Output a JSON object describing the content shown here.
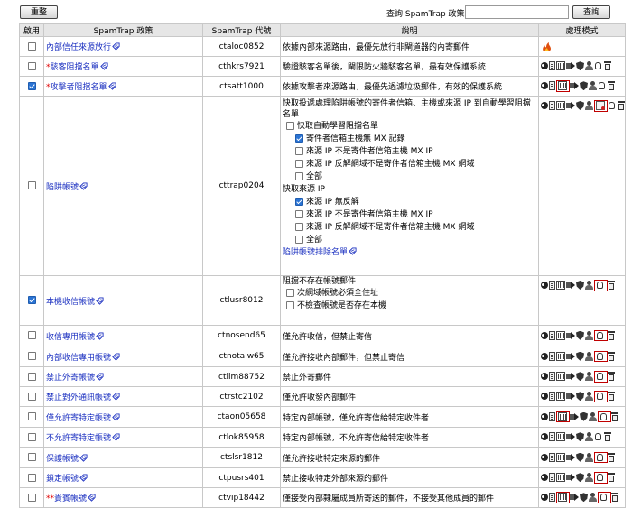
{
  "toolbar": {
    "reset_label": "重整",
    "search_label": "查詢 SpamTrap 政策",
    "search_value": "",
    "search_button": "查詢"
  },
  "columns": [
    "啟用",
    "SpamTrap 政策",
    "SpamTrap 代號",
    "說明",
    "處理模式"
  ],
  "rows": [
    {
      "enabled": false,
      "star": "",
      "name": "內部信任來源放行",
      "code": "ctaloc0852",
      "desc": "依據內部來源路由，最優先放行非閘道器的內寄郵件",
      "acts": "flame"
    },
    {
      "enabled": false,
      "star": "*",
      "name": "駭客阻擋名單",
      "code": "cthkrs7921",
      "desc": "驗證駭客名單後，閘限防火牆駭客名單，最有效保護系統",
      "acts": "std"
    },
    {
      "enabled": true,
      "star": "*",
      "name": "攻擊者阻擋名單",
      "code": "ctsatt1000",
      "desc": "依據攻擊者來源路由，最優先過濾垃圾郵件，有效的保護系統",
      "acts": "cal"
    },
    {
      "enabled": false,
      "star": "",
      "name": "陷阱帳號",
      "code": "cttrap0204",
      "desc": "快取投遞處理陷阱帳號的寄件者信箱、主機或來源 IP 到自動學習阻擋名單",
      "acts": "cert"
    },
    {
      "enabled": true,
      "star": "",
      "name": "本機收信帳號",
      "code": "ctlusr8012",
      "desc": "阻擋不存在帳號郵件",
      "acts": "hand"
    },
    {
      "enabled": false,
      "star": "",
      "name": "收信專用帳號",
      "code": "ctnosend65",
      "desc": "僅允許收信，但禁止寄信",
      "acts": "hand"
    },
    {
      "enabled": false,
      "star": "",
      "name": "內部收信專用帳號",
      "code": "ctnotalw65",
      "desc": "僅允許接收內部郵件，但禁止寄信",
      "acts": "hand"
    },
    {
      "enabled": false,
      "star": "",
      "name": "禁止外寄帳號",
      "code": "ctlim88752",
      "desc": "禁止外寄郵件",
      "acts": "hand"
    },
    {
      "enabled": false,
      "star": "",
      "name": "禁止對外通訊帳號",
      "code": "ctrstc2102",
      "desc": "僅允許收發內部郵件",
      "acts": "hand"
    },
    {
      "enabled": false,
      "star": "",
      "name": "僅允許寄特定帳號",
      "code": "ctaon05658",
      "desc": "特定內部帳號，僅允許寄信給特定收件者",
      "acts": "calhand"
    },
    {
      "enabled": false,
      "star": "",
      "name": "不允許寄特定帳號",
      "code": "ctlok85958",
      "desc": "特定內部帳號，不允許寄信給特定收件者",
      "acts": "std"
    },
    {
      "enabled": false,
      "star": "",
      "name": "保護帳號",
      "code": "ctslsr1812",
      "desc": "僅允許接收特定來源的郵件",
      "acts": "hand"
    },
    {
      "enabled": false,
      "star": "",
      "name": "鎖定帳號",
      "code": "ctpusrs401",
      "desc": "禁止接收特定外部來源的郵件",
      "acts": "hand"
    },
    {
      "enabled": false,
      "star": "**",
      "name": "貴賓帳號",
      "code": "ctvip18442",
      "desc": "僅接受內部隸屬成員所寄送的郵件，不接受其他成員的郵件",
      "acts": "calhand"
    }
  ],
  "trap_options": {
    "auto_learn": "快取自動學習阻擋名單",
    "group1": [
      {
        "checked": true,
        "label": "寄件者信箱主機無 MX 記錄"
      },
      {
        "checked": false,
        "label": "來源 IP 不是寄件者信箱主機 MX IP"
      },
      {
        "checked": false,
        "label": "來源 IP 反解網域不是寄件者信箱主機 MX 網域"
      },
      {
        "checked": false,
        "label": "全部"
      }
    ],
    "group2_title": "快取來源 IP",
    "group2": [
      {
        "checked": true,
        "label": "來源 IP 無反解"
      },
      {
        "checked": false,
        "label": "來源 IP 不是寄件者信箱主機 MX IP"
      },
      {
        "checked": false,
        "label": "來源 IP 反解網域不是寄件者信箱主機 MX 網域"
      },
      {
        "checked": false,
        "label": "全部"
      }
    ],
    "exclude_link": "陷阱帳號排除名單"
  },
  "local_options": [
    {
      "checked": false,
      "label": "次網域帳號必須全住址"
    },
    {
      "checked": false,
      "label": "不檢查帳號是否存在本機"
    }
  ]
}
